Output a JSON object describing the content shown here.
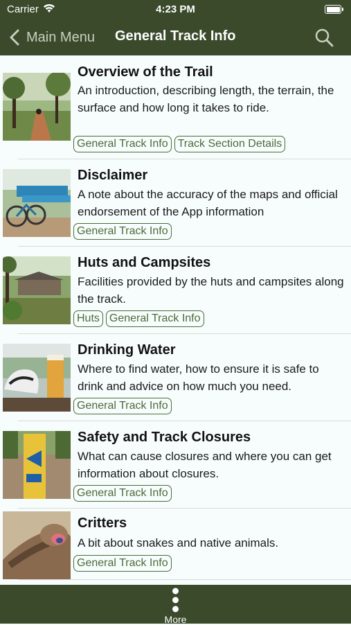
{
  "status_bar": {
    "carrier": "Carrier",
    "time": "4:23 PM"
  },
  "nav": {
    "back_label": "Main Menu",
    "title": "General Track Info"
  },
  "items": [
    {
      "title": "Overview of the Trail",
      "description": "An introduction, describing length, the terrain, the surface and how long it takes to ride.",
      "tags": [
        "General Track Info",
        "Track Section Details"
      ],
      "thumbnail": "trail-forest-photo"
    },
    {
      "title": "Disclaimer",
      "description": "A note about the accuracy of the maps and official endorsement of the App information",
      "tags": [
        "General Track Info"
      ],
      "thumbnail": "bikes-at-sign-photo"
    },
    {
      "title": "Huts and Campsites",
      "description": "Facilities provided by the huts and campsites along the track.",
      "tags": [
        "Huts",
        "General Track Info"
      ],
      "thumbnail": "hut-in-bush-photo"
    },
    {
      "title": "Drinking Water",
      "description": "Where to find water, how to ensure it is safe to drink and advice on how much you need.",
      "tags": [
        "General Track Info"
      ],
      "thumbnail": "helmet-and-beer-photo"
    },
    {
      "title": "Safety and Track Closures",
      "description": "What can cause closures and where you can get information about closures.",
      "tags": [
        "General Track Info"
      ],
      "thumbnail": "trail-marker-post-photo"
    },
    {
      "title": "Critters",
      "description": "A bit about snakes and native animals.",
      "tags": [
        "General Track Info"
      ],
      "thumbnail": "blue-tongue-lizard-photo"
    }
  ],
  "tab_bar": {
    "more_label": "More"
  },
  "colors": {
    "bar": "#3a4a2b",
    "tag": "#4c6a37",
    "background": "#f7fdfd"
  },
  "icons": [
    "back-chevron-icon",
    "search-icon",
    "more-dots-icon",
    "wifi-icon",
    "battery-icon"
  ]
}
